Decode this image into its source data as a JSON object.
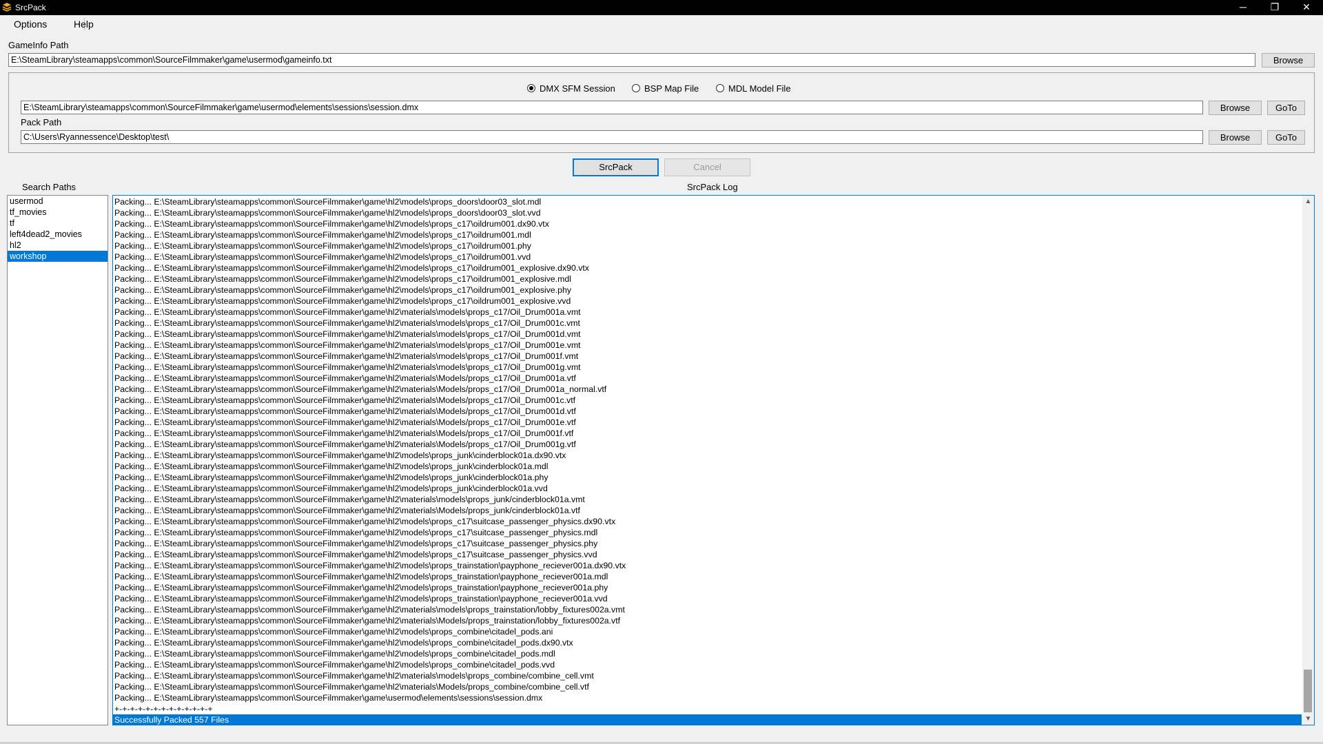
{
  "window": {
    "title": "SrcPack",
    "minimize_glyph": "─",
    "restore_glyph": "❐",
    "close_glyph": "✕"
  },
  "menu": {
    "options": "Options",
    "help": "Help"
  },
  "gameinfo": {
    "label": "GameInfo Path",
    "value": "E:\\SteamLibrary\\steamapps\\common\\SourceFilmmaker\\game\\usermod\\gameinfo.txt",
    "browse": "Browse"
  },
  "source_type": {
    "options": [
      "DMX SFM Session",
      "BSP Map File",
      "MDL Model File"
    ],
    "selected": "DMX SFM Session"
  },
  "source": {
    "value": "E:\\SteamLibrary\\steamapps\\common\\SourceFilmmaker\\game\\usermod\\elements\\sessions\\session.dmx",
    "browse": "Browse",
    "goto": "GoTo"
  },
  "pack": {
    "label": "Pack Path",
    "value": "C:\\Users\\Ryannessence\\Desktop\\test\\",
    "browse": "Browse",
    "goto": "GoTo"
  },
  "actions": {
    "srcpack": "SrcPack",
    "cancel": "Cancel"
  },
  "search_paths": {
    "label": "Search Paths",
    "items": [
      "usermod",
      "tf_movies",
      "tf",
      "left4dead2_movies",
      "hl2",
      "workshop"
    ],
    "selected": "workshop"
  },
  "log": {
    "label": "SrcPack Log",
    "lines": [
      "Packing... E:\\SteamLibrary\\steamapps\\common\\SourceFilmmaker\\game\\hl2\\models\\props_doors\\door03_slot.mdl",
      "Packing... E:\\SteamLibrary\\steamapps\\common\\SourceFilmmaker\\game\\hl2\\models\\props_doors\\door03_slot.vvd",
      "Packing... E:\\SteamLibrary\\steamapps\\common\\SourceFilmmaker\\game\\hl2\\models\\props_c17\\oildrum001.dx90.vtx",
      "Packing... E:\\SteamLibrary\\steamapps\\common\\SourceFilmmaker\\game\\hl2\\models\\props_c17\\oildrum001.mdl",
      "Packing... E:\\SteamLibrary\\steamapps\\common\\SourceFilmmaker\\game\\hl2\\models\\props_c17\\oildrum001.phy",
      "Packing... E:\\SteamLibrary\\steamapps\\common\\SourceFilmmaker\\game\\hl2\\models\\props_c17\\oildrum001.vvd",
      "Packing... E:\\SteamLibrary\\steamapps\\common\\SourceFilmmaker\\game\\hl2\\models\\props_c17\\oildrum001_explosive.dx90.vtx",
      "Packing... E:\\SteamLibrary\\steamapps\\common\\SourceFilmmaker\\game\\hl2\\models\\props_c17\\oildrum001_explosive.mdl",
      "Packing... E:\\SteamLibrary\\steamapps\\common\\SourceFilmmaker\\game\\hl2\\models\\props_c17\\oildrum001_explosive.phy",
      "Packing... E:\\SteamLibrary\\steamapps\\common\\SourceFilmmaker\\game\\hl2\\models\\props_c17\\oildrum001_explosive.vvd",
      "Packing... E:\\SteamLibrary\\steamapps\\common\\SourceFilmmaker\\game\\hl2\\materials\\models\\props_c17/Oil_Drum001a.vmt",
      "Packing... E:\\SteamLibrary\\steamapps\\common\\SourceFilmmaker\\game\\hl2\\materials\\models\\props_c17/Oil_Drum001c.vmt",
      "Packing... E:\\SteamLibrary\\steamapps\\common\\SourceFilmmaker\\game\\hl2\\materials\\models\\props_c17/Oil_Drum001d.vmt",
      "Packing... E:\\SteamLibrary\\steamapps\\common\\SourceFilmmaker\\game\\hl2\\materials\\models\\props_c17/Oil_Drum001e.vmt",
      "Packing... E:\\SteamLibrary\\steamapps\\common\\SourceFilmmaker\\game\\hl2\\materials\\models\\props_c17/Oil_Drum001f.vmt",
      "Packing... E:\\SteamLibrary\\steamapps\\common\\SourceFilmmaker\\game\\hl2\\materials\\models\\props_c17/Oil_Drum001g.vmt",
      "Packing... E:\\SteamLibrary\\steamapps\\common\\SourceFilmmaker\\game\\hl2\\materials\\Models/props_c17/Oil_Drum001a.vtf",
      "Packing... E:\\SteamLibrary\\steamapps\\common\\SourceFilmmaker\\game\\hl2\\materials\\Models/props_c17/Oil_Drum001a_normal.vtf",
      "Packing... E:\\SteamLibrary\\steamapps\\common\\SourceFilmmaker\\game\\hl2\\materials\\Models/props_c17/Oil_Drum001c.vtf",
      "Packing... E:\\SteamLibrary\\steamapps\\common\\SourceFilmmaker\\game\\hl2\\materials\\Models/props_c17/Oil_Drum001d.vtf",
      "Packing... E:\\SteamLibrary\\steamapps\\common\\SourceFilmmaker\\game\\hl2\\materials\\Models/props_c17/Oil_Drum001e.vtf",
      "Packing... E:\\SteamLibrary\\steamapps\\common\\SourceFilmmaker\\game\\hl2\\materials\\Models/props_c17/Oil_Drum001f.vtf",
      "Packing... E:\\SteamLibrary\\steamapps\\common\\SourceFilmmaker\\game\\hl2\\materials\\Models/props_c17/Oil_Drum001g.vtf",
      "Packing... E:\\SteamLibrary\\steamapps\\common\\SourceFilmmaker\\game\\hl2\\models\\props_junk\\cinderblock01a.dx90.vtx",
      "Packing... E:\\SteamLibrary\\steamapps\\common\\SourceFilmmaker\\game\\hl2\\models\\props_junk\\cinderblock01a.mdl",
      "Packing... E:\\SteamLibrary\\steamapps\\common\\SourceFilmmaker\\game\\hl2\\models\\props_junk\\cinderblock01a.phy",
      "Packing... E:\\SteamLibrary\\steamapps\\common\\SourceFilmmaker\\game\\hl2\\models\\props_junk\\cinderblock01a.vvd",
      "Packing... E:\\SteamLibrary\\steamapps\\common\\SourceFilmmaker\\game\\hl2\\materials\\models\\props_junk/cinderblock01a.vmt",
      "Packing... E:\\SteamLibrary\\steamapps\\common\\SourceFilmmaker\\game\\hl2\\materials\\Models/props_junk/cinderblock01a.vtf",
      "Packing... E:\\SteamLibrary\\steamapps\\common\\SourceFilmmaker\\game\\hl2\\models\\props_c17\\suitcase_passenger_physics.dx90.vtx",
      "Packing... E:\\SteamLibrary\\steamapps\\common\\SourceFilmmaker\\game\\hl2\\models\\props_c17\\suitcase_passenger_physics.mdl",
      "Packing... E:\\SteamLibrary\\steamapps\\common\\SourceFilmmaker\\game\\hl2\\models\\props_c17\\suitcase_passenger_physics.phy",
      "Packing... E:\\SteamLibrary\\steamapps\\common\\SourceFilmmaker\\game\\hl2\\models\\props_c17\\suitcase_passenger_physics.vvd",
      "Packing... E:\\SteamLibrary\\steamapps\\common\\SourceFilmmaker\\game\\hl2\\models\\props_trainstation\\payphone_reciever001a.dx90.vtx",
      "Packing... E:\\SteamLibrary\\steamapps\\common\\SourceFilmmaker\\game\\hl2\\models\\props_trainstation\\payphone_reciever001a.mdl",
      "Packing... E:\\SteamLibrary\\steamapps\\common\\SourceFilmmaker\\game\\hl2\\models\\props_trainstation\\payphone_reciever001a.phy",
      "Packing... E:\\SteamLibrary\\steamapps\\common\\SourceFilmmaker\\game\\hl2\\models\\props_trainstation\\payphone_reciever001a.vvd",
      "Packing... E:\\SteamLibrary\\steamapps\\common\\SourceFilmmaker\\game\\hl2\\materials\\models\\props_trainstation/lobby_fixtures002a.vmt",
      "Packing... E:\\SteamLibrary\\steamapps\\common\\SourceFilmmaker\\game\\hl2\\materials\\Models/props_trainstation/lobby_fixtures002a.vtf",
      "Packing... E:\\SteamLibrary\\steamapps\\common\\SourceFilmmaker\\game\\hl2\\models\\props_combine\\citadel_pods.ani",
      "Packing... E:\\SteamLibrary\\steamapps\\common\\SourceFilmmaker\\game\\hl2\\models\\props_combine\\citadel_pods.dx90.vtx",
      "Packing... E:\\SteamLibrary\\steamapps\\common\\SourceFilmmaker\\game\\hl2\\models\\props_combine\\citadel_pods.mdl",
      "Packing... E:\\SteamLibrary\\steamapps\\common\\SourceFilmmaker\\game\\hl2\\models\\props_combine\\citadel_pods.vvd",
      "Packing... E:\\SteamLibrary\\steamapps\\common\\SourceFilmmaker\\game\\hl2\\materials\\models\\props_combine/combine_cell.vmt",
      "Packing... E:\\SteamLibrary\\steamapps\\common\\SourceFilmmaker\\game\\hl2\\materials\\Models/props_combine/combine_cell.vtf",
      "Packing... E:\\SteamLibrary\\steamapps\\common\\SourceFilmmaker\\game\\usermod\\elements\\sessions\\session.dmx",
      "+-+-+-+-+-+-+-+-+-+-+-+-+",
      "Successfully Packed 557 Files"
    ],
    "selected_line": "Successfully Packed 557 Files"
  },
  "colors": {
    "accent": "#0078d7",
    "titlebar": "#000000",
    "window_bg": "#f0f0f0"
  },
  "icons": {
    "app": "srcpack-stack-icon",
    "scroll_up": "chevron-up-icon",
    "scroll_down": "chevron-down-icon"
  }
}
